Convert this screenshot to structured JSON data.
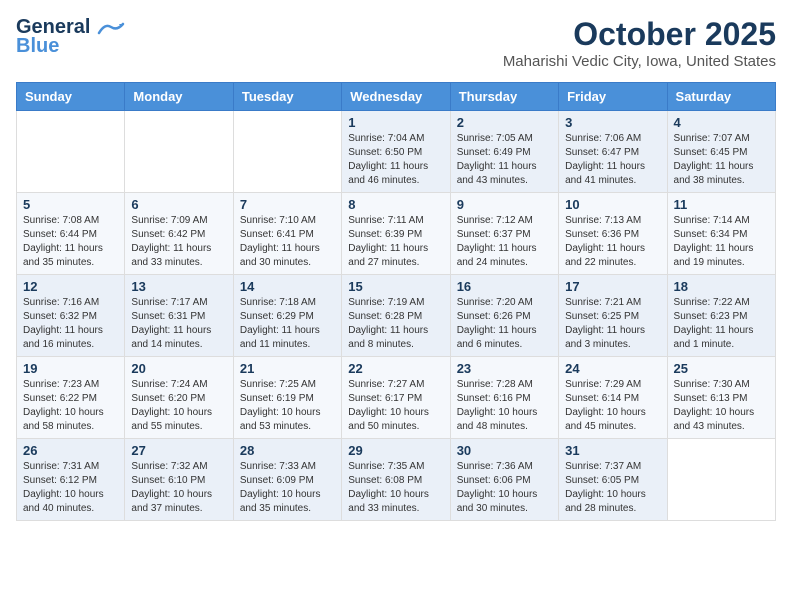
{
  "header": {
    "logo_line1": "General",
    "logo_line2": "Blue",
    "month": "October 2025",
    "location": "Maharishi Vedic City, Iowa, United States"
  },
  "weekdays": [
    "Sunday",
    "Monday",
    "Tuesday",
    "Wednesday",
    "Thursday",
    "Friday",
    "Saturday"
  ],
  "weeks": [
    [
      {
        "day": "",
        "info": ""
      },
      {
        "day": "",
        "info": ""
      },
      {
        "day": "",
        "info": ""
      },
      {
        "day": "1",
        "info": "Sunrise: 7:04 AM\nSunset: 6:50 PM\nDaylight: 11 hours\nand 46 minutes."
      },
      {
        "day": "2",
        "info": "Sunrise: 7:05 AM\nSunset: 6:49 PM\nDaylight: 11 hours\nand 43 minutes."
      },
      {
        "day": "3",
        "info": "Sunrise: 7:06 AM\nSunset: 6:47 PM\nDaylight: 11 hours\nand 41 minutes."
      },
      {
        "day": "4",
        "info": "Sunrise: 7:07 AM\nSunset: 6:45 PM\nDaylight: 11 hours\nand 38 minutes."
      }
    ],
    [
      {
        "day": "5",
        "info": "Sunrise: 7:08 AM\nSunset: 6:44 PM\nDaylight: 11 hours\nand 35 minutes."
      },
      {
        "day": "6",
        "info": "Sunrise: 7:09 AM\nSunset: 6:42 PM\nDaylight: 11 hours\nand 33 minutes."
      },
      {
        "day": "7",
        "info": "Sunrise: 7:10 AM\nSunset: 6:41 PM\nDaylight: 11 hours\nand 30 minutes."
      },
      {
        "day": "8",
        "info": "Sunrise: 7:11 AM\nSunset: 6:39 PM\nDaylight: 11 hours\nand 27 minutes."
      },
      {
        "day": "9",
        "info": "Sunrise: 7:12 AM\nSunset: 6:37 PM\nDaylight: 11 hours\nand 24 minutes."
      },
      {
        "day": "10",
        "info": "Sunrise: 7:13 AM\nSunset: 6:36 PM\nDaylight: 11 hours\nand 22 minutes."
      },
      {
        "day": "11",
        "info": "Sunrise: 7:14 AM\nSunset: 6:34 PM\nDaylight: 11 hours\nand 19 minutes."
      }
    ],
    [
      {
        "day": "12",
        "info": "Sunrise: 7:16 AM\nSunset: 6:32 PM\nDaylight: 11 hours\nand 16 minutes."
      },
      {
        "day": "13",
        "info": "Sunrise: 7:17 AM\nSunset: 6:31 PM\nDaylight: 11 hours\nand 14 minutes."
      },
      {
        "day": "14",
        "info": "Sunrise: 7:18 AM\nSunset: 6:29 PM\nDaylight: 11 hours\nand 11 minutes."
      },
      {
        "day": "15",
        "info": "Sunrise: 7:19 AM\nSunset: 6:28 PM\nDaylight: 11 hours\nand 8 minutes."
      },
      {
        "day": "16",
        "info": "Sunrise: 7:20 AM\nSunset: 6:26 PM\nDaylight: 11 hours\nand 6 minutes."
      },
      {
        "day": "17",
        "info": "Sunrise: 7:21 AM\nSunset: 6:25 PM\nDaylight: 11 hours\nand 3 minutes."
      },
      {
        "day": "18",
        "info": "Sunrise: 7:22 AM\nSunset: 6:23 PM\nDaylight: 11 hours\nand 1 minute."
      }
    ],
    [
      {
        "day": "19",
        "info": "Sunrise: 7:23 AM\nSunset: 6:22 PM\nDaylight: 10 hours\nand 58 minutes."
      },
      {
        "day": "20",
        "info": "Sunrise: 7:24 AM\nSunset: 6:20 PM\nDaylight: 10 hours\nand 55 minutes."
      },
      {
        "day": "21",
        "info": "Sunrise: 7:25 AM\nSunset: 6:19 PM\nDaylight: 10 hours\nand 53 minutes."
      },
      {
        "day": "22",
        "info": "Sunrise: 7:27 AM\nSunset: 6:17 PM\nDaylight: 10 hours\nand 50 minutes."
      },
      {
        "day": "23",
        "info": "Sunrise: 7:28 AM\nSunset: 6:16 PM\nDaylight: 10 hours\nand 48 minutes."
      },
      {
        "day": "24",
        "info": "Sunrise: 7:29 AM\nSunset: 6:14 PM\nDaylight: 10 hours\nand 45 minutes."
      },
      {
        "day": "25",
        "info": "Sunrise: 7:30 AM\nSunset: 6:13 PM\nDaylight: 10 hours\nand 43 minutes."
      }
    ],
    [
      {
        "day": "26",
        "info": "Sunrise: 7:31 AM\nSunset: 6:12 PM\nDaylight: 10 hours\nand 40 minutes."
      },
      {
        "day": "27",
        "info": "Sunrise: 7:32 AM\nSunset: 6:10 PM\nDaylight: 10 hours\nand 37 minutes."
      },
      {
        "day": "28",
        "info": "Sunrise: 7:33 AM\nSunset: 6:09 PM\nDaylight: 10 hours\nand 35 minutes."
      },
      {
        "day": "29",
        "info": "Sunrise: 7:35 AM\nSunset: 6:08 PM\nDaylight: 10 hours\nand 33 minutes."
      },
      {
        "day": "30",
        "info": "Sunrise: 7:36 AM\nSunset: 6:06 PM\nDaylight: 10 hours\nand 30 minutes."
      },
      {
        "day": "31",
        "info": "Sunrise: 7:37 AM\nSunset: 6:05 PM\nDaylight: 10 hours\nand 28 minutes."
      },
      {
        "day": "",
        "info": ""
      }
    ]
  ]
}
